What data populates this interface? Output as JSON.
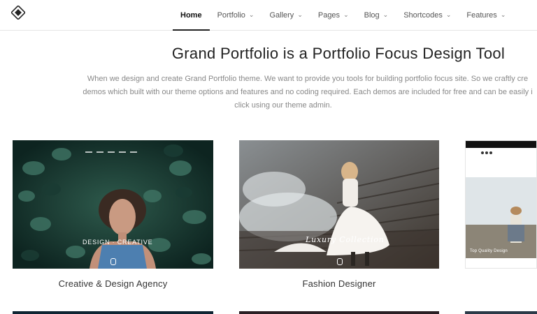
{
  "nav": {
    "items": [
      {
        "label": "Home",
        "active": true,
        "has_menu": false
      },
      {
        "label": "Portfolio",
        "active": false,
        "has_menu": true
      },
      {
        "label": "Gallery",
        "active": false,
        "has_menu": true
      },
      {
        "label": "Pages",
        "active": false,
        "has_menu": true
      },
      {
        "label": "Blog",
        "active": false,
        "has_menu": true
      },
      {
        "label": "Shortcodes",
        "active": false,
        "has_menu": true
      },
      {
        "label": "Features",
        "active": false,
        "has_menu": true
      }
    ]
  },
  "hero": {
    "title": "Grand Portfolio is a Portfolio Focus Design Tool",
    "lines": [
      "When we design and create Grand Portfolio theme. We want to provide you tools for building portfolio focus site. So we craftly cre",
      "demos which built with our theme options and features and no coding required. Each demos are included for free and can be easily i",
      "click using our theme admin."
    ]
  },
  "demos": [
    {
      "title": "Creative & Design Agency",
      "overlay": "DESIGN · CREATIVE"
    },
    {
      "title": "Fashion Designer",
      "overlay": "Luxury Collection"
    },
    {
      "title": "",
      "overlay": "Top Quality Design"
    }
  ],
  "colors": {
    "accent": "#222222",
    "muted_text": "#888888",
    "nav_text": "#555555"
  }
}
